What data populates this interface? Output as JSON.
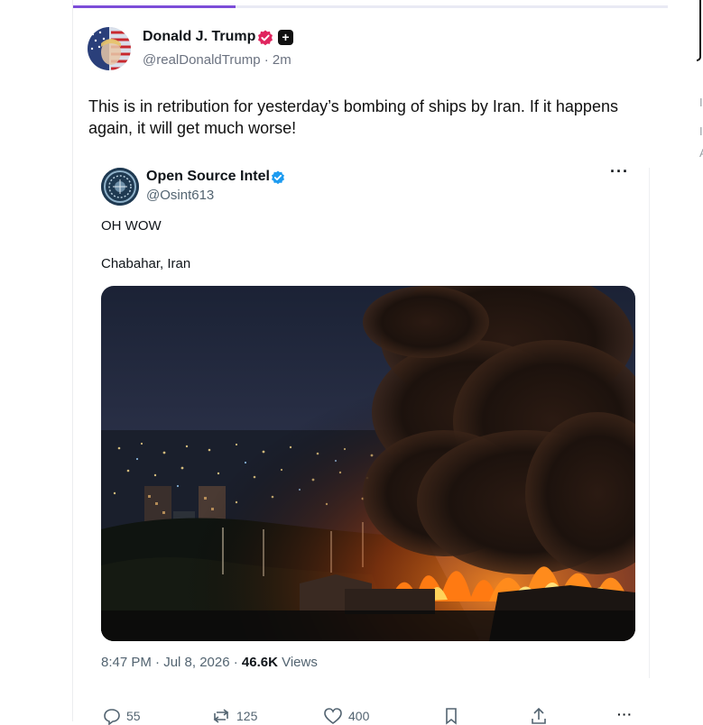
{
  "post": {
    "author_name": "Donald J. Trump",
    "author_handle": "@realDonaldTrump",
    "separator": "·",
    "time_ago": "2m",
    "text": "This is in retribution for yesterday’s bombing of ships by Iran. If it happens again, it will get much worse!"
  },
  "embed": {
    "author_name": "Open Source Intel",
    "author_handle": "@Osint613",
    "more_label": "···",
    "line1": "OH WOW",
    "line2": "Chabahar, Iran",
    "timestamp": "8:47 PM · Jul 8, 2026 · ",
    "views_count": "46.6K",
    "views_label": " Views"
  },
  "actions": {
    "replies": "55",
    "reposts": "125",
    "likes": "400",
    "more": "···"
  },
  "colors": {
    "accent": "#7c4dd8",
    "verified_blue": "#1d9bf0",
    "truth_badge": "#e0245e"
  }
}
